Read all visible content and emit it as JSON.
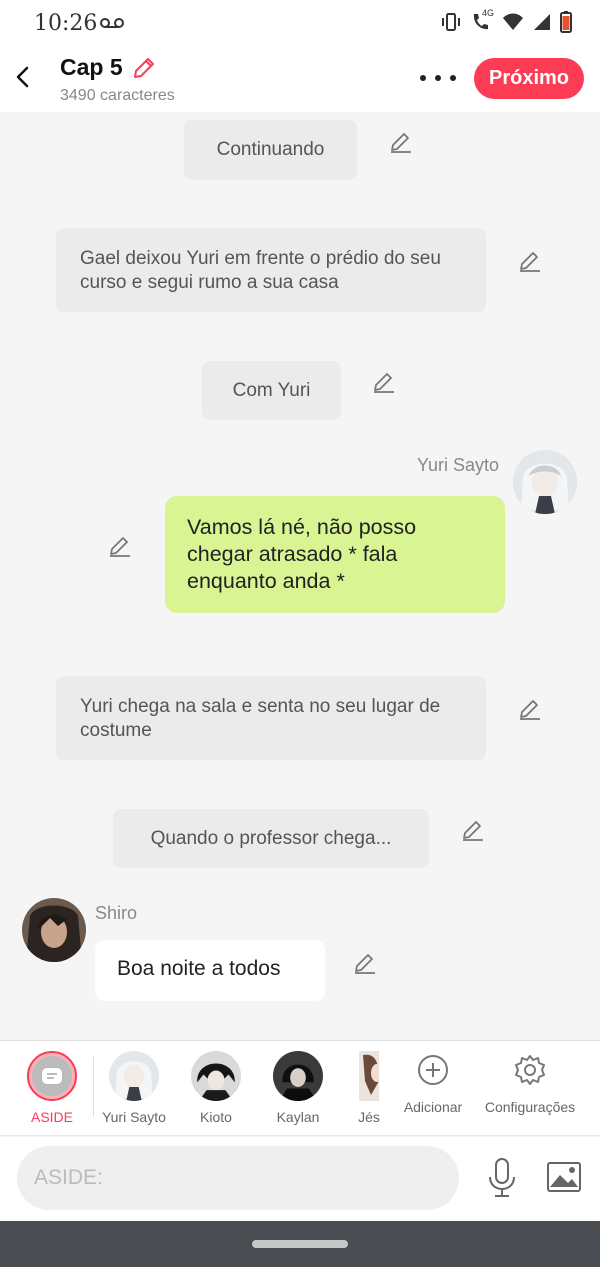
{
  "status_bar": {
    "time": "10:26",
    "network": "4G",
    "icons": [
      "voicemail-icon",
      "vibrate-icon",
      "call-4g-icon",
      "wifi-icon",
      "signal-icon",
      "battery-low-icon"
    ]
  },
  "header": {
    "title": "Cap 5",
    "subtitle": "3490 caracteres",
    "next_label": "Próximo",
    "accent": "#fc3b55"
  },
  "messages": [
    {
      "type": "narration",
      "text": "Continuando"
    },
    {
      "type": "narration",
      "text": "Gael deixou Yuri em frente o prédio do seu curso e segui rumo a sua casa"
    },
    {
      "type": "narration",
      "text": "Com Yuri"
    },
    {
      "type": "dialogue",
      "side": "right",
      "speaker": "Yuri Sayto",
      "text": "Vamos lá né, não posso chegar atrasado * fala enquanto anda *",
      "bubble_color": "#d8f493"
    },
    {
      "type": "narration",
      "text": "Yuri chega na sala e senta no seu lugar de costume"
    },
    {
      "type": "narration",
      "text": "Quando o professor chega..."
    },
    {
      "type": "dialogue",
      "side": "left",
      "speaker": "Shiro",
      "text": "Boa noite a todos",
      "bubble_color": "#ffffff"
    }
  ],
  "characters": [
    {
      "label": "ASIDE",
      "selected": true
    },
    {
      "label": "Yuri Sayto"
    },
    {
      "label": "Kioto"
    },
    {
      "label": "Kaylan"
    },
    {
      "label": "Jés"
    },
    {
      "label": "Adicionar"
    },
    {
      "label": "Configurações"
    }
  ],
  "composer": {
    "placeholder": "ASIDE:"
  }
}
